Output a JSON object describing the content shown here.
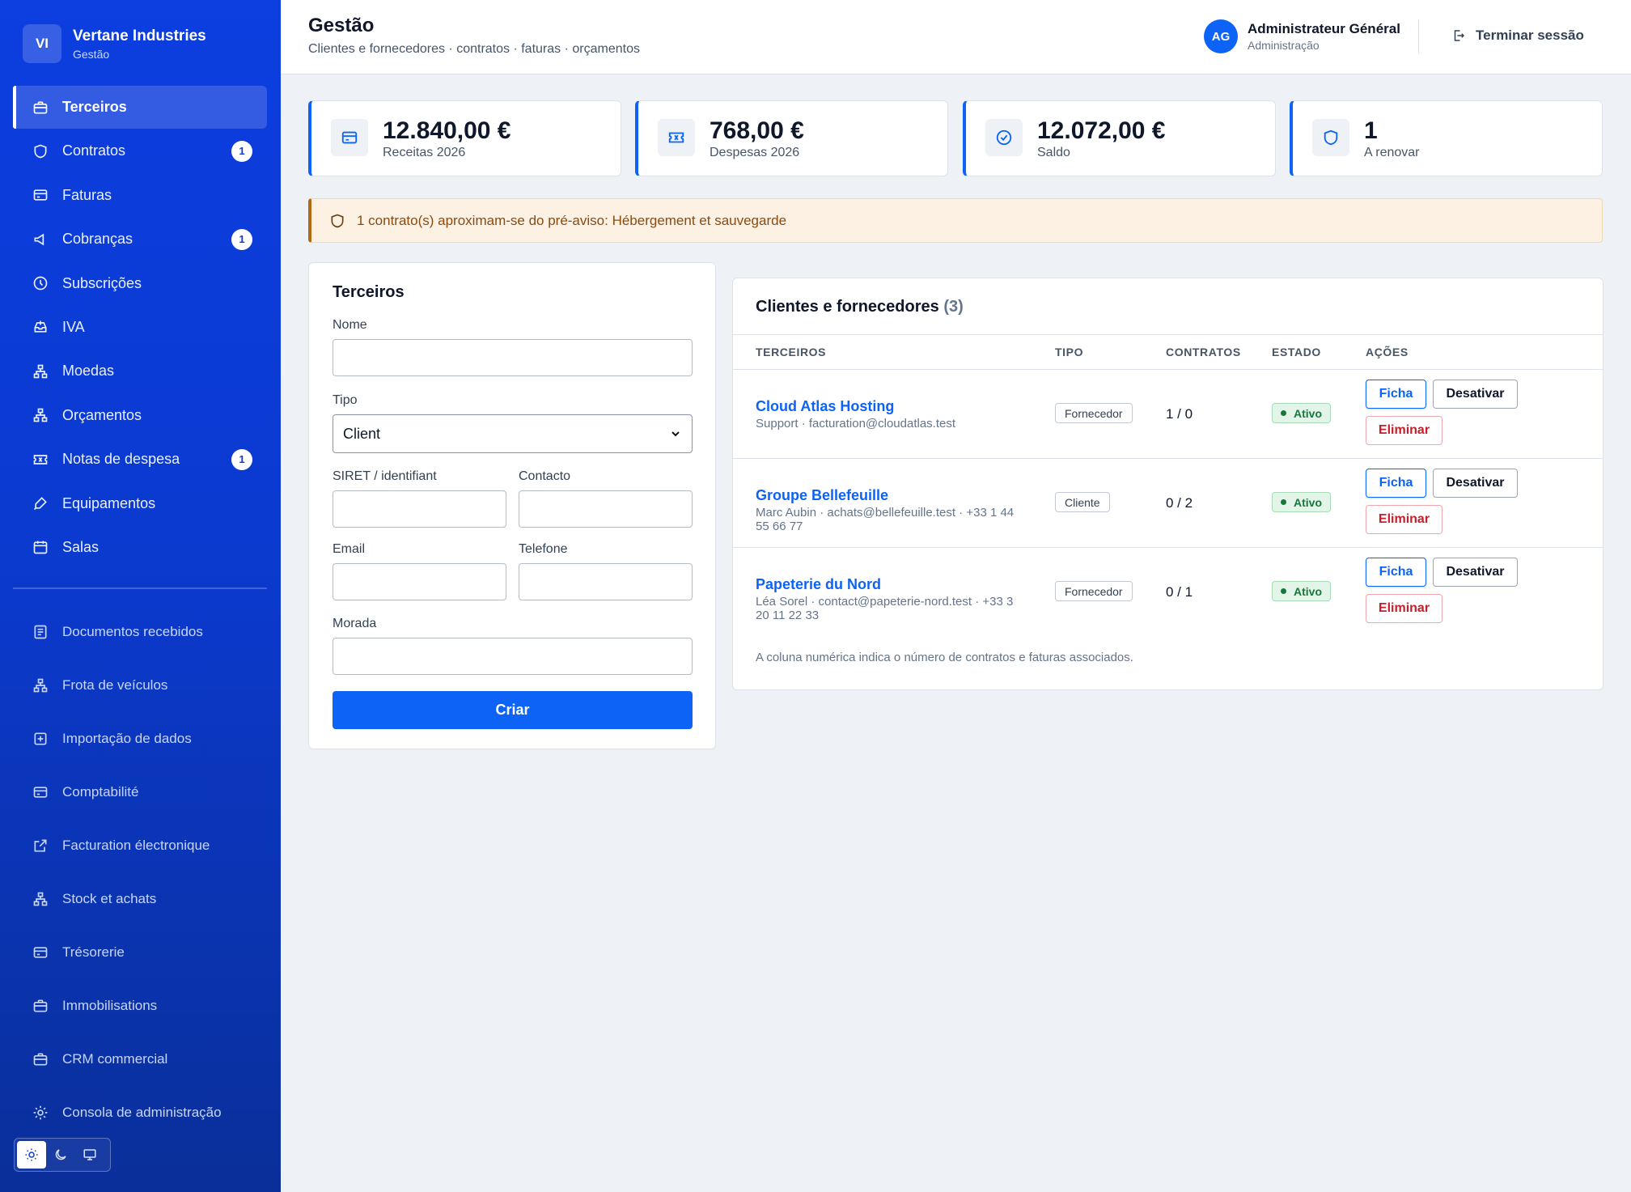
{
  "brand": {
    "logo": "VI",
    "name": "Vertane Industries",
    "subtitle": "Gestão"
  },
  "sidebar": {
    "primary": [
      {
        "label": "Terceiros",
        "icon": "briefcase-icon",
        "active": true
      },
      {
        "label": "Contratos",
        "icon": "shield-icon",
        "badge": "1"
      },
      {
        "label": "Faturas",
        "icon": "credit-card-icon"
      },
      {
        "label": "Cobranças",
        "icon": "megaphone-icon",
        "badge": "1"
      },
      {
        "label": "Subscrições",
        "icon": "clock-icon"
      },
      {
        "label": "IVA",
        "icon": "inbox-icon"
      },
      {
        "label": "Moedas",
        "icon": "sitemap-icon"
      },
      {
        "label": "Orçamentos",
        "icon": "sitemap-icon"
      },
      {
        "label": "Notas de despesa",
        "icon": "ticket-icon",
        "badge": "1"
      },
      {
        "label": "Equipamentos",
        "icon": "pen-icon"
      },
      {
        "label": "Salas",
        "icon": "calendar-icon"
      }
    ],
    "secondary": [
      {
        "label": "Documentos recebidos",
        "icon": "document-icon"
      },
      {
        "label": "Frota de veículos",
        "icon": "sitemap-icon"
      },
      {
        "label": "Importação de dados",
        "icon": "plus-square-icon"
      },
      {
        "label": "Comptabilité",
        "icon": "credit-card-icon"
      },
      {
        "label": "Facturation électronique",
        "icon": "external-link-icon"
      },
      {
        "label": "Stock et achats",
        "icon": "sitemap-icon"
      },
      {
        "label": "Trésorerie",
        "icon": "credit-card-icon"
      },
      {
        "label": "Immobilisations",
        "icon": "briefcase-icon"
      },
      {
        "label": "CRM commercial",
        "icon": "briefcase-icon"
      },
      {
        "label": "Consola de administração",
        "icon": "gear-icon"
      }
    ],
    "theme": {
      "options": [
        "sun-icon",
        "moon-icon",
        "monitor-icon"
      ],
      "selected": "sun-icon"
    }
  },
  "header": {
    "title": "Gestão",
    "subtitle": "Clientes e fornecedores · contratos · faturas · orçamentos",
    "user": {
      "initials": "AG",
      "name": "Administrateur Général",
      "role": "Administração"
    },
    "logout_label": "Terminar sessão"
  },
  "kpis": [
    {
      "value": "12.840,00 €",
      "label": "Receitas 2026",
      "icon": "credit-card-icon"
    },
    {
      "value": "768,00 €",
      "label": "Despesas 2026",
      "icon": "ticket-icon"
    },
    {
      "value": "12.072,00 €",
      "label": "Saldo",
      "icon": "check-circle-icon"
    },
    {
      "value": "1",
      "label": "A renovar",
      "icon": "shield-icon"
    }
  ],
  "alert": {
    "text": "1 contrato(s) aproximam-se do pré-aviso: Hébergement et sauvegarde",
    "icon": "shield-icon"
  },
  "form": {
    "title": "Terceiros",
    "name_label": "Nome",
    "name_value": "",
    "type_label": "Tipo",
    "type_value": "Client",
    "siret_label": "SIRET / identifiant",
    "siret_value": "",
    "contact_label": "Contacto",
    "contact_value": "",
    "email_label": "Email",
    "email_value": "",
    "phone_label": "Telefone",
    "phone_value": "",
    "address_label": "Morada",
    "address_value": "",
    "submit_label": "Criar"
  },
  "table": {
    "title": "Clientes e fornecedores",
    "count": "(3)",
    "columns": [
      "TERCEIROS",
      "TIPO",
      "CONTRATOS",
      "ESTADO",
      "AÇÕES"
    ],
    "rows": [
      {
        "name": "Cloud Atlas Hosting",
        "meta": "Support · facturation@cloudatlas.test",
        "type": "Fornecedor",
        "ratio": "1 / 0",
        "status": "Ativo"
      },
      {
        "name": "Groupe Bellefeuille",
        "meta": "Marc Aubin · achats@bellefeuille.test · +33 1 44 55 66 77",
        "type": "Cliente",
        "ratio": "0 / 2",
        "status": "Ativo"
      },
      {
        "name": "Papeterie du Nord",
        "meta": "Léa Sorel · contact@papeterie-nord.test · +33 3 20 11 22 33",
        "type": "Fornecedor",
        "ratio": "0 / 1",
        "status": "Ativo"
      }
    ],
    "actions": {
      "view": "Ficha",
      "deactivate": "Desativar",
      "delete": "Eliminar"
    },
    "note": "A coluna numérica indica o número de contratos e faturas associados."
  },
  "colors": {
    "primary": "#0d63f5",
    "sidebar": "#0b3ad0",
    "success": "#17773b",
    "danger": "#c81e2c",
    "warning_bg": "#fcf1e3"
  }
}
